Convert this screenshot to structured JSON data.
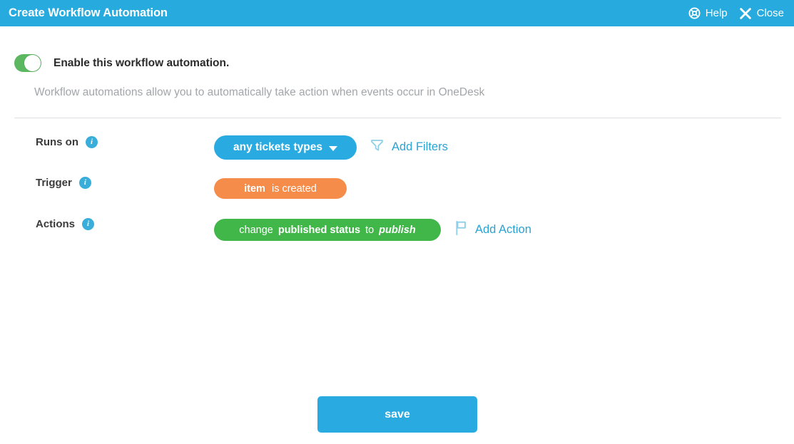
{
  "header": {
    "title": "Create Workflow Automation",
    "help_label": "Help",
    "help_icon": "lifebuoy-icon",
    "close_label": "Close",
    "close_icon": "close-x-icon",
    "background_color": "#27aadd"
  },
  "enable": {
    "label": "Enable this workflow automation.",
    "state": "on",
    "on_color": "#5cb860"
  },
  "description": "Workflow automations allow you to automatically take action when events occur in OneDesk",
  "rows": {
    "runs_on": {
      "label": "Runs on",
      "info_icon": "info-icon",
      "pill_text": "any tickets types",
      "pill_color": "#29abe2",
      "caret_icon": "chevron-down-icon",
      "link_label": "Add Filters",
      "link_icon": "filter-funnel-icon",
      "link_color": "#29a3d4"
    },
    "trigger": {
      "label": "Trigger",
      "info_icon": "info-icon",
      "pill_subject": "item",
      "pill_predicate": "is created",
      "pill_color": "#f58c4a"
    },
    "actions": {
      "label": "Actions",
      "info_icon": "info-icon",
      "pill_verb": "change",
      "pill_field": "published status",
      "pill_connector": "to",
      "pill_value": "publish",
      "pill_color": "#41b649",
      "link_label": "Add Action",
      "link_icon": "flag-icon",
      "link_color": "#29a3d4"
    }
  },
  "footer": {
    "save_label": "save",
    "save_color": "#29abe2"
  }
}
